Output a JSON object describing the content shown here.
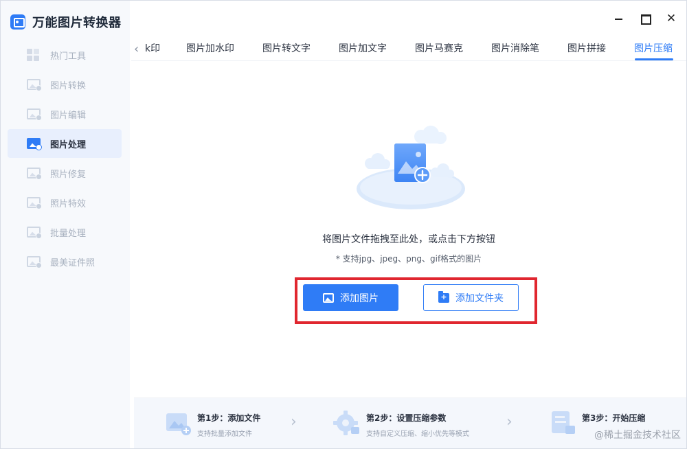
{
  "app": {
    "title": "万能图片转换器"
  },
  "window_controls": {
    "minimize": "",
    "maximize": "",
    "close": "✕"
  },
  "sidebar": {
    "items": [
      {
        "label": "热门工具",
        "icon": "grid-icon",
        "active": false
      },
      {
        "label": "图片转换",
        "icon": "image-convert-icon",
        "active": false
      },
      {
        "label": "图片编辑",
        "icon": "image-edit-icon",
        "active": false
      },
      {
        "label": "图片处理",
        "icon": "image-process-icon",
        "active": true
      },
      {
        "label": "照片修复",
        "icon": "photo-repair-icon",
        "active": false
      },
      {
        "label": "照片特效",
        "icon": "photo-effect-icon",
        "active": false
      },
      {
        "label": "批量处理",
        "icon": "batch-icon",
        "active": false
      },
      {
        "label": "最美证件照",
        "icon": "id-photo-icon",
        "active": false
      }
    ]
  },
  "tabs": {
    "prev_icon": "chevron-left-icon",
    "items": [
      {
        "label": "k印",
        "active": false
      },
      {
        "label": "图片加水印",
        "active": false
      },
      {
        "label": "图片转文字",
        "active": false
      },
      {
        "label": "图片加文字",
        "active": false
      },
      {
        "label": "图片马赛克",
        "active": false
      },
      {
        "label": "图片消除笔",
        "active": false
      },
      {
        "label": "图片拼接",
        "active": false
      },
      {
        "label": "图片压缩",
        "active": true
      }
    ]
  },
  "dropzone": {
    "hint": "将图片文件拖拽至此处，或点击下方按钮",
    "formats": "* 支持jpg、jpeg、png、gif格式的图片"
  },
  "buttons": {
    "add_image": "添加图片",
    "add_folder": "添加文件夹"
  },
  "steps": [
    {
      "title": "第1步：添加文件",
      "desc": "支持批量添加文件"
    },
    {
      "title": "第2步：设置压缩参数",
      "desc": "支持自定义压缩、缩小优先等模式"
    },
    {
      "title": "第3步：开始压缩",
      "desc": ""
    }
  ],
  "watermark": "@稀土掘金技术社区",
  "colors": {
    "accent": "#2f7cf6",
    "highlight_border": "#e0262f",
    "sidebar_bg": "#f7f9fc"
  }
}
